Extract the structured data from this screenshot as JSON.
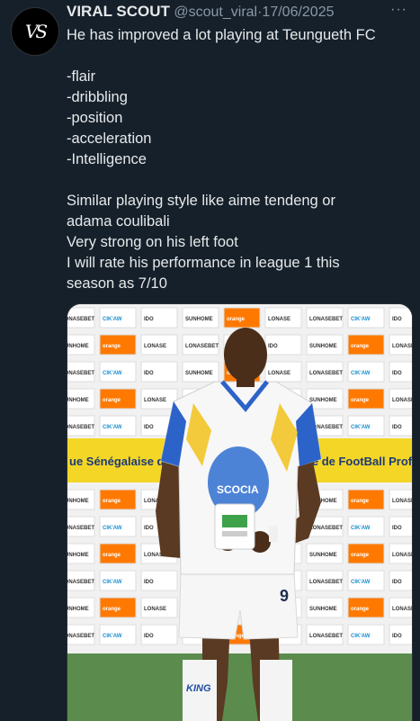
{
  "tweet": {
    "avatar_text": "VS",
    "display_name": "VIRAL SCOUT",
    "handle": "@scout_viral",
    "separator": "·",
    "date": "17/06/2025",
    "more": "···",
    "lines": {
      "l1": "He has improved a lot playing at Teungueth FC",
      "l2": "-flair",
      "l3": "-dribbling",
      "l4": "-position",
      "l5": "-acceleration",
      "l6": "-Intelligence",
      "l7": "Similar playing style like aime tendeng or",
      "l8": "adama coulibali",
      "l9": "Very strong on his left foot",
      "l10": "I will rate his performance in league 1 this",
      "l11": "season as  7/10"
    }
  },
  "media": {
    "banner_left": "ue Sénégalaise de FootB",
    "banner_right": "galaise de FootBall Profe",
    "sponsors": [
      "LONASEBET",
      "CIK'AW",
      "IDO",
      "SUNHOME",
      "orange",
      "LONASE"
    ],
    "trophy_text": "SCOCIA",
    "shirt_number": "9",
    "shirt_brand": "KING"
  },
  "colors": {
    "background": "#15202b",
    "text": "#e7e9ea",
    "muted": "#8b98a5",
    "orange": "#ff7900",
    "banner": "#f4d626",
    "grass": "#5b8c4e"
  }
}
